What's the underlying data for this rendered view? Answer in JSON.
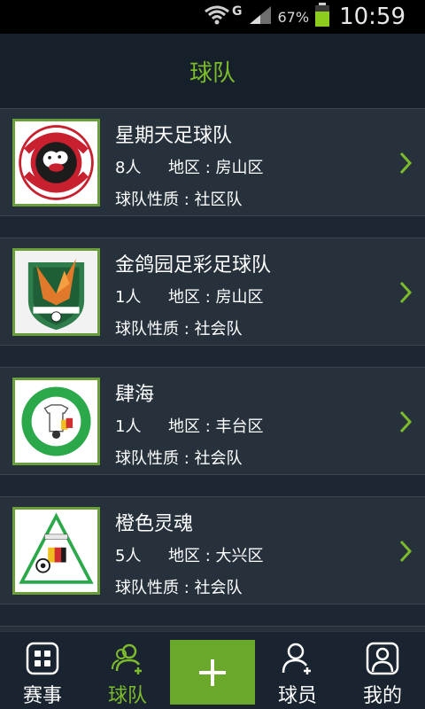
{
  "status_bar": {
    "network_label": "G",
    "battery": "67%",
    "time": "10:59"
  },
  "header": {
    "title": "球队"
  },
  "teams": [
    {
      "name": "星期天足球队",
      "members": "8人",
      "region": "地区 : 房山区",
      "type": "球队性质 : 社区队",
      "logo": "barnsley-fc-crest"
    },
    {
      "name": "金鸽园足彩足球队",
      "members": "1人",
      "region": "地区 : 房山区",
      "type": "球队性质 : 社会队",
      "logo": "winged-shield-crest"
    },
    {
      "name": "肆海",
      "members": "1人",
      "region": "地区 : 丰台区",
      "type": "球队性质 : 社会队",
      "logo": "soccer-club-green-ring"
    },
    {
      "name": "橙色灵魂",
      "members": "5人",
      "region": "地区 : 大兴区",
      "type": "球队性质 : 社会队",
      "logo": "club-soccer-triangle"
    }
  ],
  "tab_bar": {
    "tabs": [
      {
        "label": "赛事",
        "icon": "grid-icon"
      },
      {
        "label": "球队",
        "icon": "team-add-icon"
      },
      {
        "label": "",
        "icon": "plus-icon"
      },
      {
        "label": "球员",
        "icon": "player-add-icon"
      },
      {
        "label": "我的",
        "icon": "profile-icon"
      }
    ],
    "active": "球队"
  },
  "colors": {
    "accent": "#7cbb2b",
    "background": "#1c2733",
    "card": "#26313c",
    "add_button": "#6aa82b"
  }
}
